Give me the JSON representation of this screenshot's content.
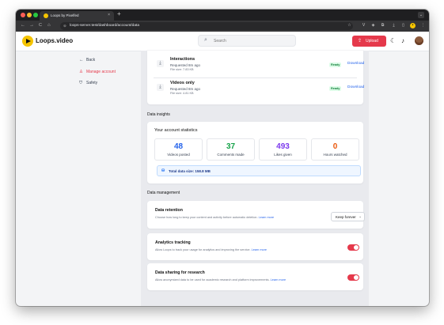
{
  "browser": {
    "tab_title": "Loops by Pixelfed",
    "tab_close": "×",
    "new_tab": "+",
    "url": "loops-server.test/dashboard/account/data",
    "nav_back": "←",
    "nav_forward": "→",
    "nav_reload": "C",
    "nav_home": "⌂"
  },
  "header": {
    "brand": "Loops.video",
    "search_placeholder": "Search",
    "upload_label": "Upload"
  },
  "sidebar": {
    "back_label": "Back",
    "items": [
      {
        "label": "Manage account",
        "active": true
      },
      {
        "label": "Safety",
        "active": false
      }
    ]
  },
  "exports": [
    {
      "name": "Interactions",
      "requested": "Requested 8m ago",
      "file_size": "File size: 7.83 KB",
      "status": "Ready",
      "action": "Download"
    },
    {
      "name": "Videos only",
      "requested": "Requested 8m ago",
      "file_size": "File size: 4.81 KB",
      "status": "Ready",
      "action": "Download"
    }
  ],
  "insights": {
    "section_title": "Data insights",
    "card_title": "Your account statistics",
    "stats": [
      {
        "value": "48",
        "label": "Videos posted",
        "color": "#2563eb"
      },
      {
        "value": "37",
        "label": "Comments made",
        "color": "#16a34a"
      },
      {
        "value": "493",
        "label": "Likes given",
        "color": "#7c3aed"
      },
      {
        "value": "0",
        "label": "Hours watched",
        "color": "#ea580c"
      }
    ],
    "total_label": "Total data size: 158.8 MB"
  },
  "management": {
    "section_title": "Data management",
    "retention": {
      "title": "Data retention",
      "description": "Choose how long to keep your content and activity before automatic deletion.",
      "link": "Learn more",
      "selected": "Keep forever"
    },
    "analytics": {
      "title": "Analytics tracking",
      "description": "Allow Loops to track your usage for analytics and improving the service.",
      "link": "Learn more",
      "enabled": true
    },
    "research": {
      "title": "Data sharing for research",
      "description": "Allow anonymized data to be used for academic research and platform improvements.",
      "link": "Learn more",
      "enabled": true
    }
  },
  "colors": {
    "accent": "#e5394b",
    "link": "#2563eb",
    "brand_yellow": "#f5c400"
  }
}
